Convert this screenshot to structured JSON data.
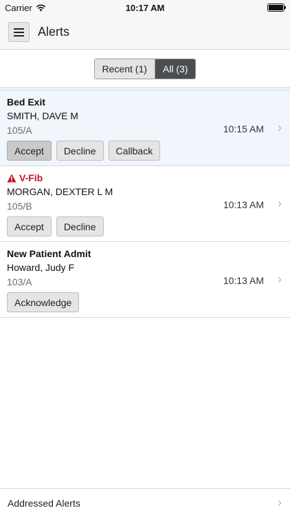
{
  "status_bar": {
    "carrier": "Carrier",
    "time": "10:17 AM"
  },
  "navbar": {
    "title": "Alerts"
  },
  "segments": [
    {
      "label": "Recent (1)",
      "active": false
    },
    {
      "label": "All (3)",
      "active": true
    }
  ],
  "alerts": [
    {
      "title": "Bed Exit",
      "patient": "SMITH, DAVE M",
      "room": "105/A",
      "time": "10:15 AM",
      "buttons": [
        "Accept",
        "Decline",
        "Callback"
      ]
    },
    {
      "title": "V-Fib",
      "patient": "MORGAN, DEXTER L M",
      "room": "105/B",
      "time": "10:13 AM",
      "buttons": [
        "Accept",
        "Decline"
      ]
    },
    {
      "title": "New Patient Admit",
      "patient": "Howard, Judy F",
      "room": "103/A",
      "time": "10:13 AM",
      "buttons": [
        "Acknowledge"
      ]
    }
  ],
  "footer": {
    "label": "Addressed Alerts"
  },
  "colors": {
    "critical": "#c0161b",
    "segment_active": "#4a4e52",
    "highlight": "#f0f6fb"
  },
  "icons": {
    "menu": "hamburger-icon",
    "chevron": "chevron-right-icon",
    "warning": "warning-triangle-icon",
    "wifi": "wifi-icon",
    "battery": "battery-icon"
  }
}
